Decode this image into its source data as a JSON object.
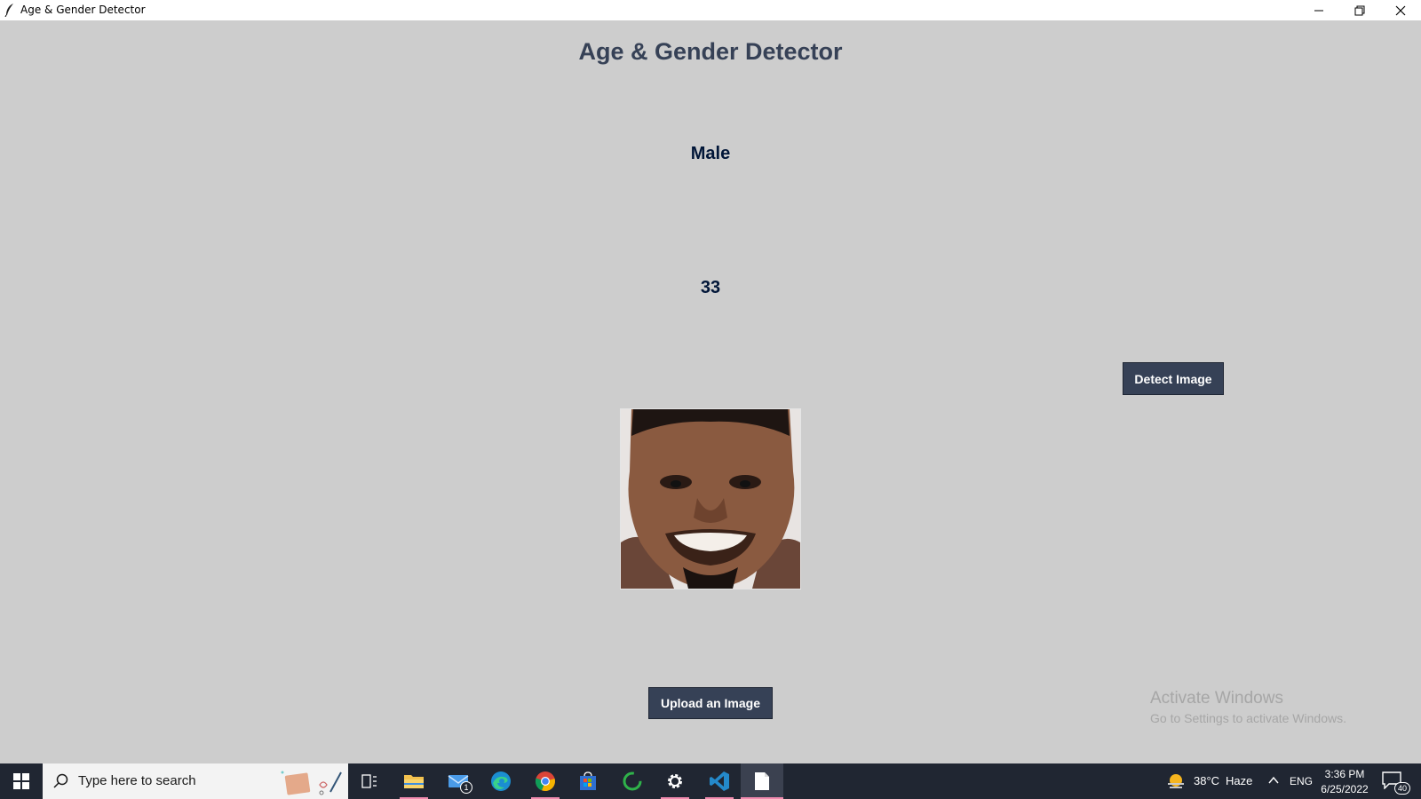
{
  "window": {
    "title": "Age & Gender Detector",
    "controls": [
      "minimize-icon",
      "restore-icon",
      "close-icon"
    ]
  },
  "app": {
    "heading": "Age & Gender Detector",
    "gender_result": "Male",
    "age_result": "33",
    "detect_button": "Detect Image",
    "upload_button": "Upload an Image",
    "photo_icon": "face-photo"
  },
  "colors": {
    "background": "#cdcdcd",
    "heading": "#364156",
    "result_text": "#011638",
    "button_bg": "#364156",
    "button_text": "#ffffff",
    "taskbar": "#202632"
  },
  "watermark": {
    "line1": "Activate Windows",
    "line2": "Go to Settings to activate Windows."
  },
  "taskbar": {
    "search_placeholder": "Type here to search",
    "apps": [
      "task-view-icon",
      "file-explorer-icon",
      "mail-icon",
      "edge-icon",
      "chrome-icon",
      "store-icon",
      "circle-app-icon",
      "settings-icon",
      "vscode-icon",
      "notepad-icon"
    ],
    "mail_badge": "1",
    "weather_temp": "38°C",
    "weather_desc": "Haze",
    "language": "ENG",
    "time": "3:36 PM",
    "date": "6/25/2022",
    "notification_count": "40"
  }
}
